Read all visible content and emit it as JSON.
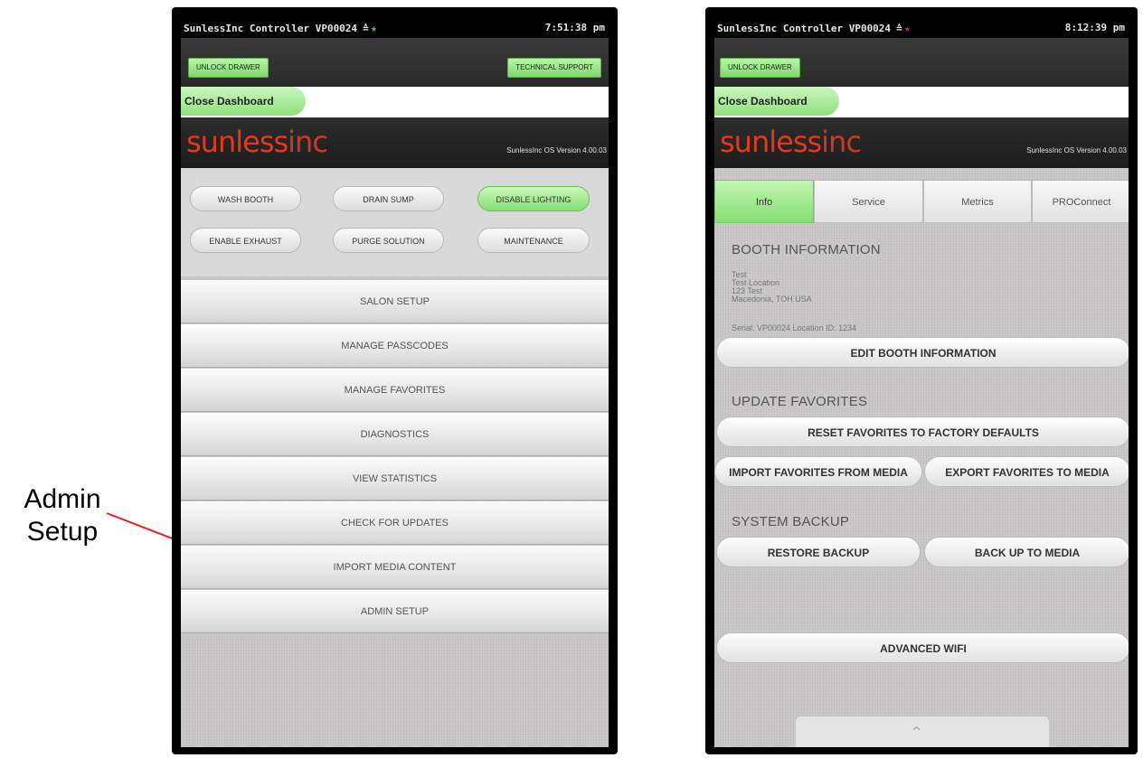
{
  "annotation": {
    "line1": "Admin",
    "line2": "Setup"
  },
  "phone1": {
    "status_title": "SunlessInc Controller  VP00024",
    "status_time": "7:51:38 pm",
    "unlock_drawer": "UNLOCK DRAWER",
    "technical_support": "TECHNICAL SUPPORT",
    "close_dashboard": "Close Dashboard",
    "logo_bold": "sunless",
    "logo_thin": "inc",
    "version": "SunlessInc OS Version 4.00.03",
    "actions": [
      "WASH BOOTH",
      "DRAIN SUMP",
      "DISABLE LIGHTING",
      "ENABLE EXHAUST",
      "PURGE SOLUTION",
      "MAINTENANCE"
    ],
    "menu": [
      "SALON SETUP",
      "MANAGE PASSCODES",
      "MANAGE FAVORITES",
      "DIAGNOSTICS",
      "VIEW STATISTICS",
      "CHECK FOR UPDATES",
      "IMPORT MEDIA CONTENT",
      "ADMIN SETUP"
    ]
  },
  "phone2": {
    "status_title": "SunlessInc Controller  VP00024",
    "status_time": "8:12:39 pm",
    "unlock_drawer": "UNLOCK DRAWER",
    "close_dashboard": "Close Dashboard",
    "logo_bold": "sunless",
    "logo_thin": "inc",
    "version": "SunlessInc OS Version 4.00.03",
    "tabs": [
      "Info",
      "Service",
      "Metrics",
      "PROConnect"
    ],
    "booth_info_heading": "BOOTH INFORMATION",
    "address": [
      "Test",
      "Test Location",
      "123 Test",
      "Macedonia, TOH USA"
    ],
    "serial": "Serial: VP00024   Location ID: 1234",
    "edit_booth": "EDIT BOOTH INFORMATION",
    "update_favorites_heading": "UPDATE FAVORITES",
    "reset_favorites": "RESET FAVORITES TO FACTORY DEFAULTS",
    "import_favorites": "IMPORT FAVORITES FROM MEDIA",
    "export_favorites": "EXPORT FAVORITES TO MEDIA",
    "system_backup_heading": "SYSTEM BACKUP",
    "restore_backup": "RESTORE BACKUP",
    "back_up": "BACK UP TO MEDIA",
    "advanced_wifi": "ADVANCED WIFI"
  },
  "colors": {
    "accent_green": "#86de72",
    "brand_red": "#e23a1e",
    "star_green": "#2ecc2e",
    "star_red": "#e02020",
    "arrow_red": "#e8231c"
  }
}
